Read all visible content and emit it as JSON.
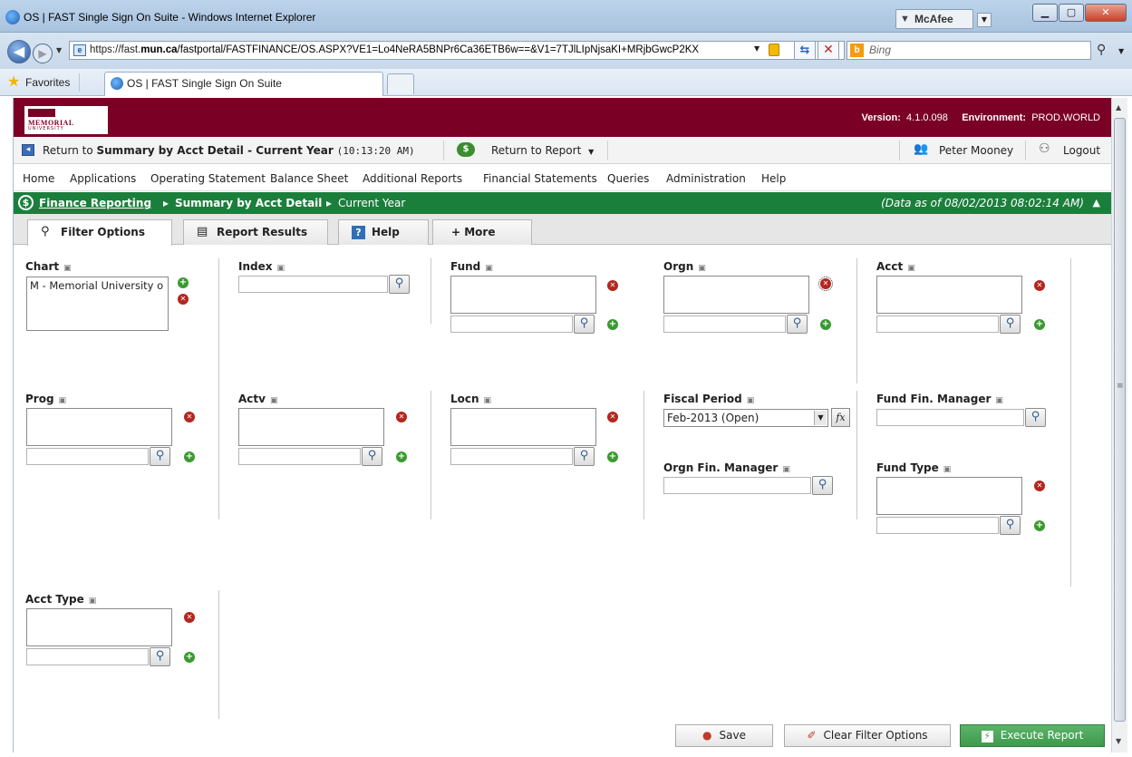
{
  "window": {
    "title": "OS | FAST Single Sign On Suite - Windows Internet Explorer",
    "mcafee_label": "McAfee"
  },
  "addressbar": {
    "url_prefix": "https://fast.",
    "url_host": "mun.ca",
    "url_rest": "/fastportal/FASTFINANCE/OS.ASPX?VE1=Lo4NeRA5BNPr6Ca36ETB6w==&V1=7TJlLIpNjsaKI+MRjbGwcP2KX",
    "search_placeholder": "Bing"
  },
  "favbar": {
    "favorites_label": "Favorites",
    "tab_title": "OS | FAST Single Sign On Suite"
  },
  "banner": {
    "logo_text": "MEMORIAL",
    "logo_sub": "UNIVERSITY",
    "version_label": "Version:",
    "version_value": "4.1.0.098",
    "environment_label": "Environment:",
    "environment_value": "PROD.WORLD"
  },
  "toolbar": {
    "return_prefix": "Return to ",
    "return_target": "Summary by Acct Detail - Current Year",
    "return_time": "(10:13:20 AM)",
    "return_report": "Return to Report",
    "user_name": "Peter Mooney",
    "logout": "Logout"
  },
  "menu": {
    "items": [
      "Home",
      "Applications",
      "Operating Statement",
      "Balance Sheet",
      "Additional Reports",
      "Financial Statements",
      "Queries",
      "Administration",
      "Help"
    ]
  },
  "breadcrumb": {
    "items": [
      "Finance Reporting",
      "Summary by Acct Detail",
      "Current Year"
    ],
    "data_as_of": "(Data as of 08/02/2013 08:02:14 AM)"
  },
  "tabs": [
    {
      "label": "Filter Options",
      "active": true
    },
    {
      "label": "Report Results",
      "active": false
    },
    {
      "label": "Help",
      "active": false
    },
    {
      "label": "+ More",
      "active": false
    }
  ],
  "filters": {
    "chart": {
      "label": "Chart",
      "selected": "M - Memorial University o"
    },
    "index": {
      "label": "Index"
    },
    "fund": {
      "label": "Fund"
    },
    "orgn": {
      "label": "Orgn"
    },
    "acct": {
      "label": "Acct"
    },
    "prog": {
      "label": "Prog"
    },
    "actv": {
      "label": "Actv"
    },
    "locn": {
      "label": "Locn"
    },
    "fiscal_period": {
      "label": "Fiscal Period",
      "value": "Feb-2013 (Open)"
    },
    "fund_fin_manager": {
      "label": "Fund Fin. Manager"
    },
    "orgn_fin_manager": {
      "label": "Orgn Fin. Manager"
    },
    "fund_type": {
      "label": "Fund Type"
    },
    "acct_type": {
      "label": "Acct Type"
    }
  },
  "actions": {
    "save": "Save",
    "clear": "Clear Filter Options",
    "execute": "Execute Report"
  },
  "colors": {
    "banner": "#7a0026",
    "breadcrumb_bar": "#1b7f3c",
    "execute_button": "#3d9a4c"
  }
}
